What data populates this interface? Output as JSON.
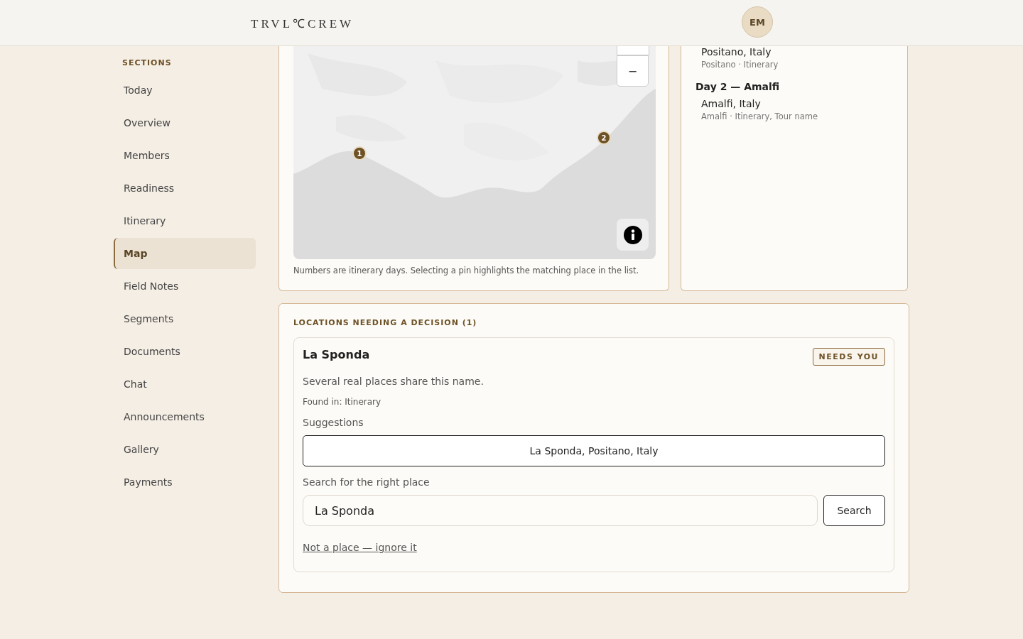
{
  "header": {
    "logo": "TRVL℃CREW",
    "avatar": "EM"
  },
  "sidebar": {
    "heading": "SECTIONS",
    "items": [
      {
        "label": "Today",
        "selected": false
      },
      {
        "label": "Overview",
        "selected": false
      },
      {
        "label": "Members",
        "selected": false
      },
      {
        "label": "Readiness",
        "selected": false
      },
      {
        "label": "Itinerary",
        "selected": false
      },
      {
        "label": "Map",
        "selected": true
      },
      {
        "label": "Field Notes",
        "selected": false
      },
      {
        "label": "Segments",
        "selected": false
      },
      {
        "label": "Documents",
        "selected": false
      },
      {
        "label": "Chat",
        "selected": false
      },
      {
        "label": "Announcements",
        "selected": false
      },
      {
        "label": "Gallery",
        "selected": false
      },
      {
        "label": "Payments",
        "selected": false
      }
    ]
  },
  "map": {
    "zoom_out": "−",
    "pins": [
      {
        "label": "1"
      },
      {
        "label": "2"
      }
    ],
    "caption": "Numbers are itinerary days. Selecting a pin highlights the matching place in the list."
  },
  "places": {
    "days": [
      {
        "places": [
          {
            "name": "Positano, Italy",
            "meta": "Positano · Itinerary"
          }
        ]
      },
      {
        "title": "Day 2 — Amalfi",
        "places": [
          {
            "name": "Amalfi, Italy",
            "meta": "Amalfi · Itinerary, Tour name"
          }
        ]
      }
    ]
  },
  "decisions": {
    "heading": "LOCATIONS NEEDING A DECISION (1)",
    "items": [
      {
        "name": "La Sponda",
        "badge": "NEEDS YOU",
        "description": "Several real places share this name.",
        "found_in": "Found in: Itinerary",
        "suggestions_label": "Suggestions",
        "suggestions": [
          "La Sponda, Positano, Italy"
        ],
        "search_label": "Search for the right place",
        "search_value": "La Sponda",
        "search_button": "Search",
        "ignore_link": "Not a place — ignore it"
      }
    ]
  }
}
